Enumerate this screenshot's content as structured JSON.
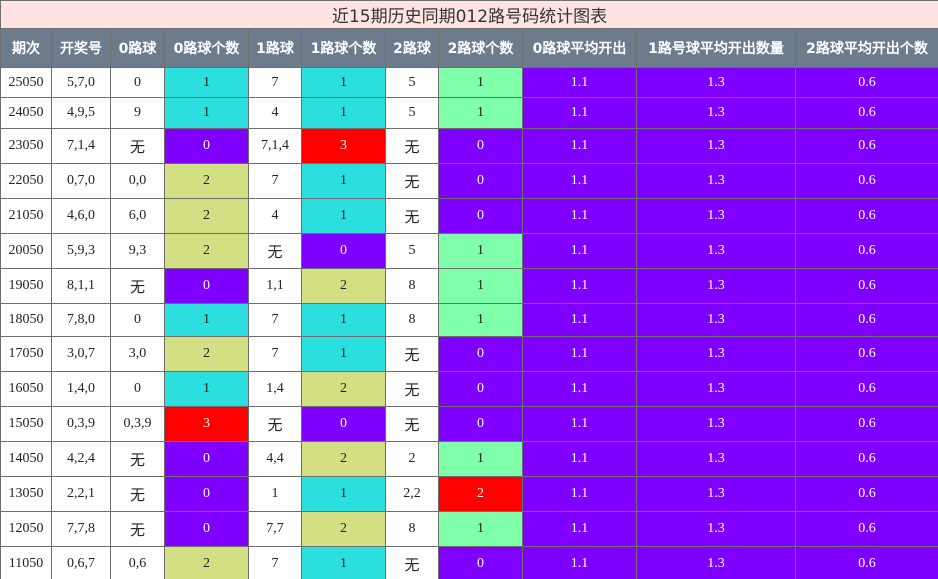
{
  "title": "近15期历史同期012路号码统计图表",
  "headers": [
    "期次",
    "开奖号",
    "0路球",
    "0路球个数",
    "1路球",
    "1路球个数",
    "2路球",
    "2路球个数",
    "0路球平均开出",
    "1路号球平均开出数量",
    "2路球平均开出个数"
  ],
  "empty_mark": "无",
  "averages": [
    "1.1",
    "1.3",
    "0.6"
  ],
  "colors": {
    "count_0": "#7f00ff",
    "count_1": "#2bdfdf",
    "count_2": "#d4df83",
    "count_2_in_2road": "#7fffaa",
    "count_3": "#ff0000"
  },
  "rows": [
    {
      "period": "25050",
      "number": "5,7,0",
      "r0": "0",
      "r0c": "1",
      "r1": "7",
      "r1c": "1",
      "r2": "5",
      "r2c": "1"
    },
    {
      "period": "24050",
      "number": "4,9,5",
      "r0": "9",
      "r0c": "1",
      "r1": "4",
      "r1c": "1",
      "r2": "5",
      "r2c": "1"
    },
    {
      "period": "23050",
      "number": "7,1,4",
      "r0": "无",
      "r0c": "0",
      "r1": "7,1,4",
      "r1c": "3",
      "r2": "无",
      "r2c": "0"
    },
    {
      "period": "22050",
      "number": "0,7,0",
      "r0": "0,0",
      "r0c": "2",
      "r1": "7",
      "r1c": "1",
      "r2": "无",
      "r2c": "0"
    },
    {
      "period": "21050",
      "number": "4,6,0",
      "r0": "6,0",
      "r0c": "2",
      "r1": "4",
      "r1c": "1",
      "r2": "无",
      "r2c": "0"
    },
    {
      "period": "20050",
      "number": "5,9,3",
      "r0": "9,3",
      "r0c": "2",
      "r1": "无",
      "r1c": "0",
      "r2": "5",
      "r2c": "1"
    },
    {
      "period": "19050",
      "number": "8,1,1",
      "r0": "无",
      "r0c": "0",
      "r1": "1,1",
      "r1c": "2",
      "r2": "8",
      "r2c": "1"
    },
    {
      "period": "18050",
      "number": "7,8,0",
      "r0": "0",
      "r0c": "1",
      "r1": "7",
      "r1c": "1",
      "r2": "8",
      "r2c": "1"
    },
    {
      "period": "17050",
      "number": "3,0,7",
      "r0": "3,0",
      "r0c": "2",
      "r1": "7",
      "r1c": "1",
      "r2": "无",
      "r2c": "0"
    },
    {
      "period": "16050",
      "number": "1,4,0",
      "r0": "0",
      "r0c": "1",
      "r1": "1,4",
      "r1c": "2",
      "r2": "无",
      "r2c": "0"
    },
    {
      "period": "15050",
      "number": "0,3,9",
      "r0": "0,3,9",
      "r0c": "3",
      "r1": "无",
      "r1c": "0",
      "r2": "无",
      "r2c": "0"
    },
    {
      "period": "14050",
      "number": "4,2,4",
      "r0": "无",
      "r0c": "0",
      "r1": "4,4",
      "r1c": "2",
      "r2": "2",
      "r2c": "1"
    },
    {
      "period": "13050",
      "number": "2,2,1",
      "r0": "无",
      "r0c": "0",
      "r1": "1",
      "r1c": "1",
      "r2": "2,2",
      "r2c": "2"
    },
    {
      "period": "12050",
      "number": "7,7,8",
      "r0": "无",
      "r0c": "0",
      "r1": "7,7",
      "r1c": "2",
      "r2": "8",
      "r2c": "1"
    },
    {
      "period": "11050",
      "number": "0,6,7",
      "r0": "0,6",
      "r0c": "2",
      "r1": "7",
      "r1c": "1",
      "r2": "无",
      "r2c": "0"
    }
  ]
}
